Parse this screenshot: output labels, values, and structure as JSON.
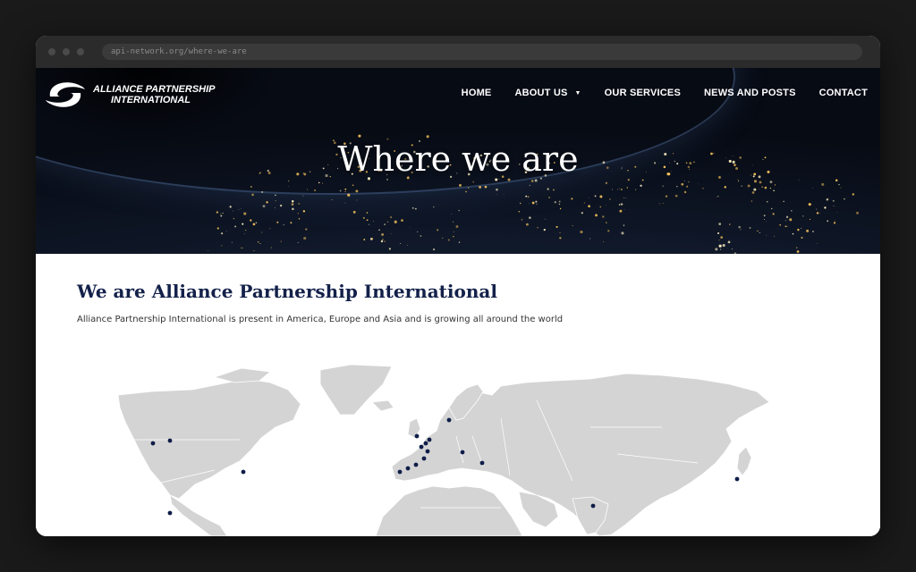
{
  "browser": {
    "url": "api-network.org/where-we-are"
  },
  "brand": {
    "line1": "ALLIANCE PARTNERSHIP",
    "line2": "INTERNATIONAL"
  },
  "nav": {
    "home": "HOME",
    "about": "ABOUT US",
    "services": "OUR SERVICES",
    "news": "NEWS AND POSTS",
    "contact": "CONTACT"
  },
  "hero": {
    "title": "Where we are"
  },
  "section": {
    "title": "We are Alliance Partnership International",
    "text": "Alliance Partnership International is present in America, Europe and Asia and is growing all around the world"
  },
  "colors": {
    "heading": "#13214a",
    "map_land": "#d4d4d4",
    "marker": "#0f1d48"
  },
  "map": {
    "markers": [
      "Vancouver",
      "Calgary",
      "Washington",
      "Mexico City",
      "Lisbon",
      "Seville",
      "Madrid",
      "Barcelona",
      "Paris",
      "Brussels",
      "Amsterdam",
      "Frankfurt",
      "Milan",
      "Stockholm",
      "Vienna",
      "Istanbul",
      "Mumbai",
      "Tokyo"
    ]
  }
}
